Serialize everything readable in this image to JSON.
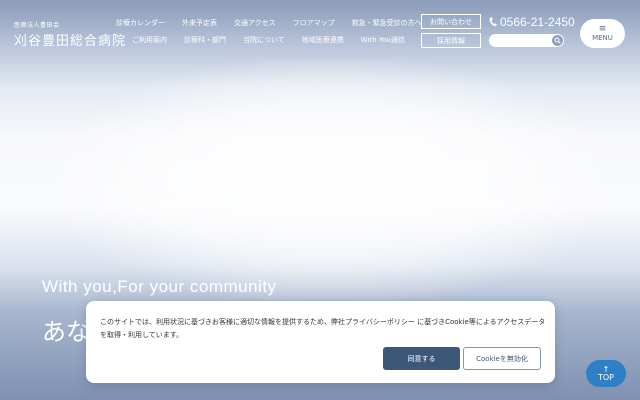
{
  "header": {
    "logo_sub": "医療法人豊田会",
    "logo_main": "刈谷豊田総合病院",
    "nav_row1": [
      "診療カレンダー",
      "外来予定表",
      "交通アクセス",
      "フロアマップ",
      "救急・緊急受診の方へ"
    ],
    "nav_row2": [
      "ご利用案内",
      "診療科・部門",
      "当院について",
      "地域医療連携",
      "With You通信"
    ],
    "contact_label": "お問い合わせ",
    "recruit_label": "採用情報",
    "phone": "0566-21-2450",
    "search_placeholder": "",
    "menu_glyph": "≡",
    "menu_label": "MENU"
  },
  "hero": {
    "tagline": "With you,For your community",
    "jp_text": "あな"
  },
  "cookie": {
    "message": "このサイトでは、利用状況に基づきお客様に適切な情報を提供するため、弊社プライバシーポリシー に基づきCookie等によるアクセスデータを取得・利用しています。",
    "agree_label": "同意する",
    "disable_label": "Cookieを無効化"
  },
  "top_button": {
    "arrow": "↑",
    "label": "TOP"
  },
  "colors": {
    "agree_button": "#3c5878",
    "top_button": "#2f7fc4",
    "menu_text": "#4f6a92"
  },
  "icons": [
    "phone-icon",
    "search-icon",
    "menu-icon",
    "arrow-up-icon"
  ]
}
